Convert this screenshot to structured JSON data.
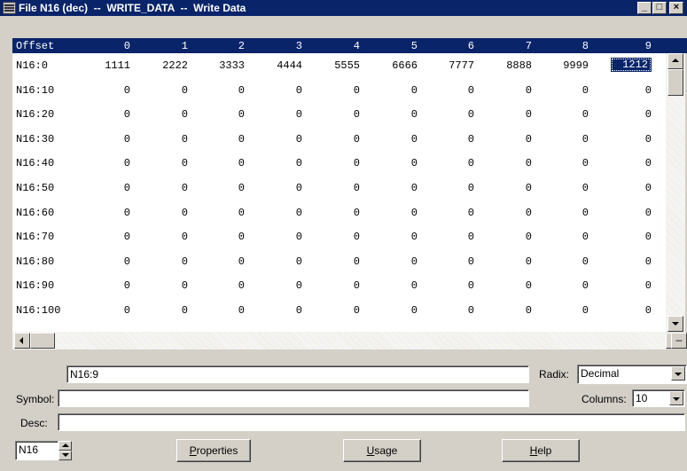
{
  "window": {
    "title": "File N16 (dec)  --  WRITE_DATA  --  Write Data",
    "minimize": "_",
    "maximize": "□",
    "close": "×"
  },
  "grid": {
    "header_offset": "Offset",
    "columns": [
      "0",
      "1",
      "2",
      "3",
      "4",
      "5",
      "6",
      "7",
      "8",
      "9"
    ],
    "rows": [
      {
        "addr": "N16:0",
        "values": [
          "1111",
          "2222",
          "3333",
          "4444",
          "5555",
          "6666",
          "7777",
          "8888",
          "9999",
          "1212"
        ]
      },
      {
        "addr": "N16:10",
        "values": [
          "0",
          "0",
          "0",
          "0",
          "0",
          "0",
          "0",
          "0",
          "0",
          "0"
        ]
      },
      {
        "addr": "N16:20",
        "values": [
          "0",
          "0",
          "0",
          "0",
          "0",
          "0",
          "0",
          "0",
          "0",
          "0"
        ]
      },
      {
        "addr": "N16:30",
        "values": [
          "0",
          "0",
          "0",
          "0",
          "0",
          "0",
          "0",
          "0",
          "0",
          "0"
        ]
      },
      {
        "addr": "N16:40",
        "values": [
          "0",
          "0",
          "0",
          "0",
          "0",
          "0",
          "0",
          "0",
          "0",
          "0"
        ]
      },
      {
        "addr": "N16:50",
        "values": [
          "0",
          "0",
          "0",
          "0",
          "0",
          "0",
          "0",
          "0",
          "0",
          "0"
        ]
      },
      {
        "addr": "N16:60",
        "values": [
          "0",
          "0",
          "0",
          "0",
          "0",
          "0",
          "0",
          "0",
          "0",
          "0"
        ]
      },
      {
        "addr": "N16:70",
        "values": [
          "0",
          "0",
          "0",
          "0",
          "0",
          "0",
          "0",
          "0",
          "0",
          "0"
        ]
      },
      {
        "addr": "N16:80",
        "values": [
          "0",
          "0",
          "0",
          "0",
          "0",
          "0",
          "0",
          "0",
          "0",
          "0"
        ]
      },
      {
        "addr": "N16:90",
        "values": [
          "0",
          "0",
          "0",
          "0",
          "0",
          "0",
          "0",
          "0",
          "0",
          "0"
        ]
      },
      {
        "addr": "N16:100",
        "values": [
          "0",
          "0",
          "0",
          "0",
          "0",
          "0",
          "0",
          "0",
          "0",
          "0"
        ]
      }
    ],
    "selected_cell": "N16:9"
  },
  "details": {
    "address_value": "N16:9",
    "radix_label": "Radix:",
    "radix_value": "Decimal",
    "symbol_label": "Symbol:",
    "symbol_value": "",
    "columns_label": "Columns:",
    "columns_value": "10",
    "desc_label": "Desc:",
    "desc_value": "",
    "file_value": "N16"
  },
  "buttons": {
    "properties_pre": "",
    "properties_ul": "P",
    "properties_post": "roperties",
    "usage_pre": "",
    "usage_ul": "U",
    "usage_post": "sage",
    "help_pre": "",
    "help_ul": "H",
    "help_post": "elp"
  },
  "colors": {
    "titlebar": "#0a246a",
    "face": "#d4d0c8",
    "selection": "#0a246a"
  }
}
